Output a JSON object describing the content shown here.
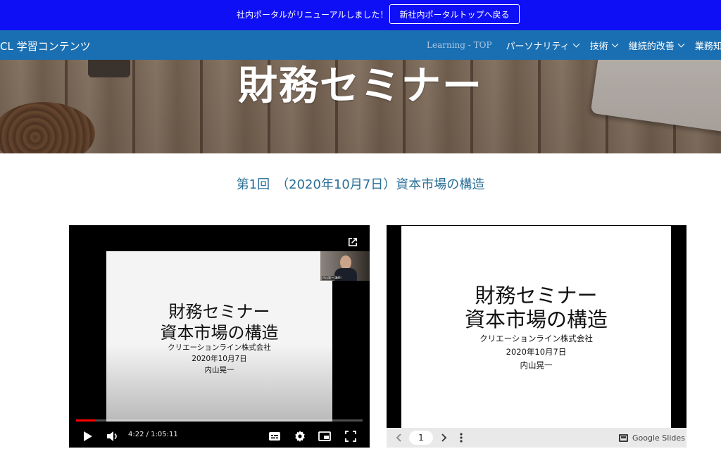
{
  "announcement": {
    "text": "社内ポータルがリニューアルしました！",
    "button_label": "新社内ポータルトップへ戻る"
  },
  "header": {
    "site_title": "CL 学習コンテンツ",
    "nav": [
      {
        "label": "Learning - TOP",
        "dropdown": false
      },
      {
        "label": "パーソナリティ",
        "dropdown": true
      },
      {
        "label": "技術",
        "dropdown": true
      },
      {
        "label": "継続的改善",
        "dropdown": true
      },
      {
        "label": "業務知",
        "dropdown": false
      }
    ]
  },
  "hero": {
    "title": "財務セミナー"
  },
  "session": {
    "heading": "第1回　（2020年10月7日）資本市場の構造"
  },
  "video": {
    "slide_title_1": "財務セミナー",
    "slide_title_2": "資本市場の構造",
    "slide_company": "クリエーションライン株式会社",
    "slide_date": "2020年10月7日",
    "slide_author": "内山晃一",
    "webcam_label": "内山晃一(講師)",
    "time_display": "4:22 / 1:05:11",
    "progress_fraction": 0.067,
    "accent_color": "#ff0000"
  },
  "slides_embed": {
    "title_1": "財務セミナー",
    "title_2": "資本市場の構造",
    "company": "クリエーションライン株式会社",
    "date": "2020年10月7日",
    "author": "内山晃一",
    "page_number": "1",
    "brand": "Google Slides"
  },
  "colors": {
    "announce_bg": "#0f0ff5",
    "header_bg": "#1a6fb2",
    "session_heading": "#2a6f97"
  }
}
